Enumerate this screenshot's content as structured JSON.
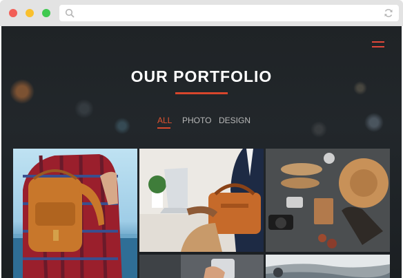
{
  "browser": {
    "dots": [
      "#f25f58",
      "#f9c02e",
      "#3fc950"
    ],
    "icons": {
      "search": "search-icon",
      "reload": "reload-icon"
    }
  },
  "page": {
    "title": "OUR PORTFOLIO",
    "accent_color": "#d8462c",
    "menu_icon": "hamburger-menu-icon"
  },
  "filters": {
    "items": [
      {
        "label": "ALL",
        "active": true
      },
      {
        "label": "PHOTO",
        "active": false
      },
      {
        "label": "DESIGN",
        "active": false
      }
    ]
  },
  "portfolio": {
    "items": [
      {
        "name": "backpack-photo"
      },
      {
        "name": "laptop-bag-photo"
      },
      {
        "name": "travel-flatlay-photo"
      },
      {
        "name": "phone-photo"
      },
      {
        "name": "coast-photo"
      }
    ]
  }
}
